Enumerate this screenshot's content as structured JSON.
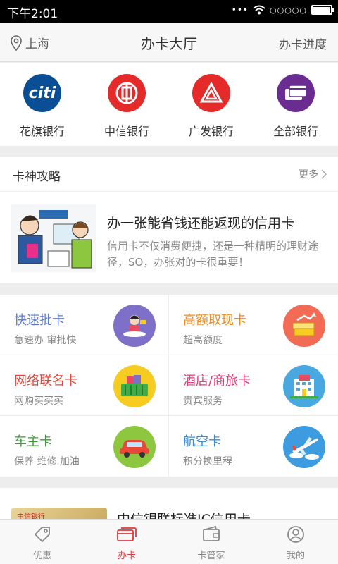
{
  "status_bar": {
    "time": "下午2:01",
    "signal": "○○○○○",
    "battery_level": 0.95
  },
  "header": {
    "location": "上海",
    "title": "办卡大厅",
    "progress": "办卡进度"
  },
  "banks": [
    {
      "name": "花旗银行",
      "logo_text": "citi",
      "color": "#0a4f96"
    },
    {
      "name": "中信银行",
      "logo_text": "",
      "color": "#e52a2a"
    },
    {
      "name": "广发银行",
      "logo_text": "",
      "color": "#e52a2a"
    },
    {
      "name": "全部银行",
      "logo_text": "",
      "color": "#6a2c91"
    }
  ],
  "strategy": {
    "title": "卡神攻略",
    "more": "更多",
    "article_title": "办一张能省钱还能返现的信用卡",
    "article_desc": "信用卡不仅消费便捷，还是一种精明的理财途径，SO，办张对的卡很重要！"
  },
  "categories": [
    {
      "title": "快速批卡",
      "sub": "急速办 审批快",
      "title_color": "#5b7bd6",
      "icon_bg": "#7e6fc9",
      "icon": "woman-plane-icon"
    },
    {
      "title": "高额取现卡",
      "sub": "超高额度",
      "title_color": "#f08a1c",
      "icon_bg": "#f16b55",
      "icon": "money-icon"
    },
    {
      "title": "网络联名卡",
      "sub": "网购买买买",
      "title_color": "#e2473f",
      "icon_bg": "#f5cc1f",
      "icon": "basket-icon"
    },
    {
      "title": "酒店/商旅卡",
      "sub": "贵宾服务",
      "title_color": "#e53c7a",
      "icon_bg": "#4aa8e0",
      "icon": "hotel-icon"
    },
    {
      "title": "车主卡",
      "sub": "保养 维修 加油",
      "title_color": "#3f9a3a",
      "icon_bg": "#8dc63f",
      "icon": "car-icon"
    },
    {
      "title": "航空卡",
      "sub": "积分换里程",
      "title_color": "#3a8bd6",
      "icon_bg": "#3d9be0",
      "icon": "airplane-icon"
    }
  ],
  "promo": {
    "card_label": "中信银行",
    "title": "中信银联标准IC信用卡"
  },
  "tabs": [
    {
      "label": "优惠",
      "icon": "tag-icon",
      "active": false
    },
    {
      "label": "办卡",
      "icon": "cards-icon",
      "active": true
    },
    {
      "label": "卡管家",
      "icon": "wallet-icon",
      "active": false
    },
    {
      "label": "我的",
      "icon": "user-icon",
      "active": false
    }
  ]
}
